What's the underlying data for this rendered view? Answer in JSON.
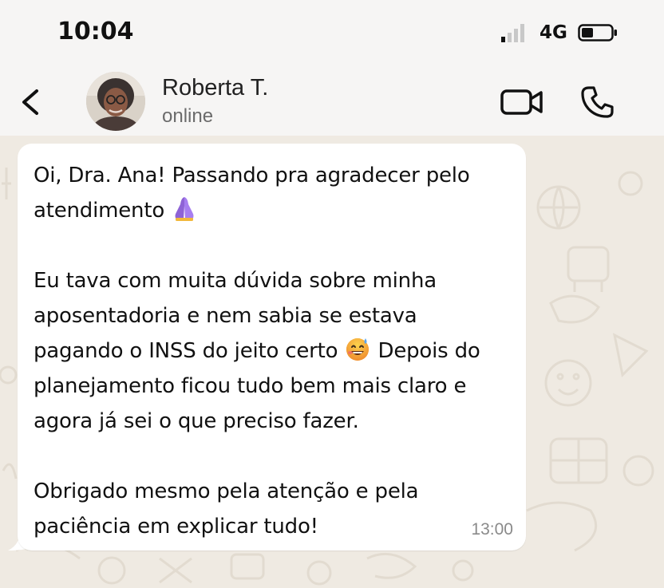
{
  "status_bar": {
    "time": "10:04",
    "network": "4G",
    "signal_icon": "signal-bars-icon",
    "battery_icon": "battery-icon",
    "battery_level": 0.3
  },
  "header": {
    "back_icon": "chevron-left-icon",
    "contact_name": "Roberta T.",
    "contact_status": "online",
    "video_icon": "video-camera-icon",
    "call_icon": "phone-icon"
  },
  "message": {
    "paragraphs": [
      "Oi, Dra. Ana! Passando pra agradecer pelo atendimento",
      "Eu tava com muita dúvida sobre minha aposentadoria e nem sabia se estava pagando o INSS do jeito certo",
      "Depois do planejamento ficou tudo bem mais claro e agora já sei o que preciso fazer.",
      "Obrigado mesmo pela atenção e pela paciência em explicar tudo!"
    ],
    "time": "13:00",
    "emojis": [
      "folded-hands-emoji",
      "grinning-sweat-emoji"
    ]
  },
  "colors": {
    "bubble": "#ffffff",
    "chat_background": "#efeae2",
    "header_background": "#f6f5f4",
    "text": "#111111",
    "secondary_text": "#6b6b6b"
  }
}
